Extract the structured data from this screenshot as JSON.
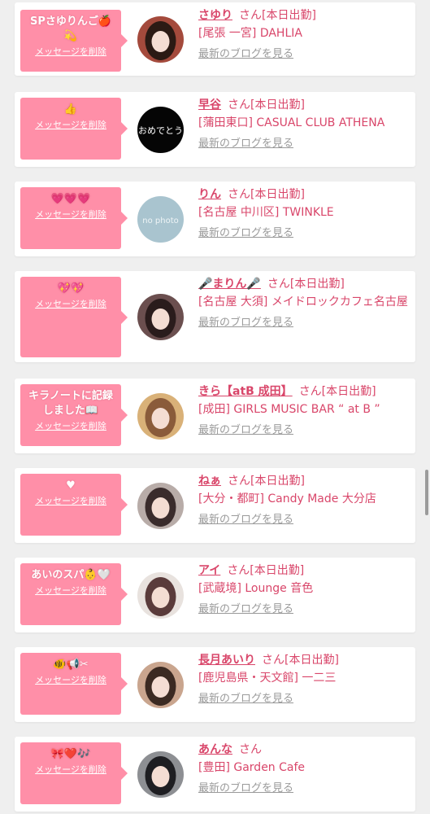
{
  "theme": {
    "accent": "#d9466a",
    "message_bg": "#ff8fa8",
    "muted": "#9a9a9a",
    "page_bg": "#efefef"
  },
  "entries": [
    {
      "message": "SPさゆりんご🍎💫",
      "delete_label": "メッセージを削除",
      "name": "さゆり",
      "suffix": "さん[本日出勤]",
      "shop": "[尾張 一宮] DAHLIA",
      "blog_label": "最新のブログを見る",
      "avatar_icon": "photo-avatar"
    },
    {
      "message": "👍",
      "delete_label": "メッセージを削除",
      "name": "早谷",
      "suffix": "さん[本日出勤]",
      "shop": "[蒲田東口] CASUAL CLUB ATHENA",
      "blog_label": "最新のブログを見る",
      "avatar_icon": "omedetou-avatar",
      "avatar_text": "おめでとう"
    },
    {
      "message": "💗💗💗",
      "delete_label": "メッセージを削除",
      "name": "りん",
      "suffix": "さん[本日出勤]",
      "shop": "[名古屋 中川区] TWINKLE",
      "blog_label": "最新のブログを見る",
      "avatar_icon": "no-photo-avatar",
      "avatar_text": "no photo"
    },
    {
      "message": "💖💖",
      "delete_label": "メッセージを削除",
      "name": "🎤まりん🎤",
      "suffix": "さん[本日出勤]",
      "shop": "[名古屋 大須] メイドロックカフェ名古屋",
      "blog_label": "最新のブログを見る",
      "avatar_icon": "photo-avatar"
    },
    {
      "message": "キラノートに記録しました📖",
      "delete_label": "メッセージを削除",
      "name": "きら【atB 成田】",
      "suffix": "さん[本日出勤]",
      "shop": "[成田] GIRLS MUSIC BAR “ at B ”",
      "blog_label": "最新のブログを見る",
      "avatar_icon": "photo-avatar"
    },
    {
      "message": "♥",
      "delete_label": "メッセージを削除",
      "name": "ねぁ",
      "suffix": "さん[本日出勤]",
      "shop": "[大分・都町] Candy Made 大分店",
      "blog_label": "最新のブログを見る",
      "avatar_icon": "photo-avatar"
    },
    {
      "message": "あいのスパ👶🤍",
      "delete_label": "メッセージを削除",
      "name": "アイ",
      "suffix": "さん[本日出勤]",
      "shop": "[武蔵境] Lounge 音色",
      "blog_label": "最新のブログを見る",
      "avatar_icon": "photo-avatar"
    },
    {
      "message": "🐠📢✂",
      "delete_label": "メッセージを削除",
      "name": "長月あいり",
      "suffix": "さん[本日出勤]",
      "shop": "[鹿児島県・天文館] 一二三",
      "blog_label": "最新のブログを見る",
      "avatar_icon": "photo-avatar"
    },
    {
      "message": "🎀❤️🎶",
      "delete_label": "メッセージを削除",
      "name": "あんな",
      "suffix": "さん",
      "shop": "[豊田] Garden Cafe",
      "blog_label": "最新のブログを見る",
      "avatar_icon": "photo-avatar"
    }
  ]
}
